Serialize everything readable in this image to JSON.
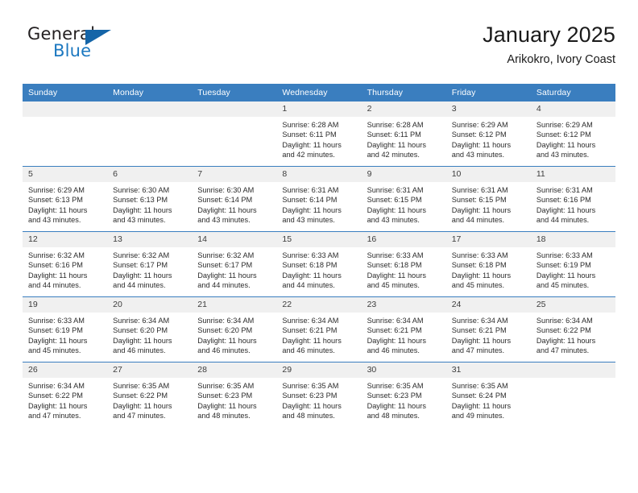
{
  "brand": {
    "name_top": "General",
    "name_bottom": "Blue",
    "flag_icon": "triangle-flag-icon",
    "accent_color": "#1c78c0",
    "flag_color": "#1565a8"
  },
  "header": {
    "title": "January 2025",
    "subtitle": "Arikokro, Ivory Coast"
  },
  "calendar": {
    "header_bg": "#3a7ebf",
    "daynum_bg": "#f0f0f0",
    "weekdays": [
      "Sunday",
      "Monday",
      "Tuesday",
      "Wednesday",
      "Thursday",
      "Friday",
      "Saturday"
    ],
    "weeks": [
      [
        {
          "day": "",
          "empty": true,
          "lines": []
        },
        {
          "day": "",
          "empty": true,
          "lines": []
        },
        {
          "day": "",
          "empty": true,
          "lines": []
        },
        {
          "day": "1",
          "empty": false,
          "lines": [
            "Sunrise: 6:28 AM",
            "Sunset: 6:11 PM",
            "Daylight: 11 hours",
            "and 42 minutes."
          ]
        },
        {
          "day": "2",
          "empty": false,
          "lines": [
            "Sunrise: 6:28 AM",
            "Sunset: 6:11 PM",
            "Daylight: 11 hours",
            "and 42 minutes."
          ]
        },
        {
          "day": "3",
          "empty": false,
          "lines": [
            "Sunrise: 6:29 AM",
            "Sunset: 6:12 PM",
            "Daylight: 11 hours",
            "and 43 minutes."
          ]
        },
        {
          "day": "4",
          "empty": false,
          "lines": [
            "Sunrise: 6:29 AM",
            "Sunset: 6:12 PM",
            "Daylight: 11 hours",
            "and 43 minutes."
          ]
        }
      ],
      [
        {
          "day": "5",
          "empty": false,
          "lines": [
            "Sunrise: 6:29 AM",
            "Sunset: 6:13 PM",
            "Daylight: 11 hours",
            "and 43 minutes."
          ]
        },
        {
          "day": "6",
          "empty": false,
          "lines": [
            "Sunrise: 6:30 AM",
            "Sunset: 6:13 PM",
            "Daylight: 11 hours",
            "and 43 minutes."
          ]
        },
        {
          "day": "7",
          "empty": false,
          "lines": [
            "Sunrise: 6:30 AM",
            "Sunset: 6:14 PM",
            "Daylight: 11 hours",
            "and 43 minutes."
          ]
        },
        {
          "day": "8",
          "empty": false,
          "lines": [
            "Sunrise: 6:31 AM",
            "Sunset: 6:14 PM",
            "Daylight: 11 hours",
            "and 43 minutes."
          ]
        },
        {
          "day": "9",
          "empty": false,
          "lines": [
            "Sunrise: 6:31 AM",
            "Sunset: 6:15 PM",
            "Daylight: 11 hours",
            "and 43 minutes."
          ]
        },
        {
          "day": "10",
          "empty": false,
          "lines": [
            "Sunrise: 6:31 AM",
            "Sunset: 6:15 PM",
            "Daylight: 11 hours",
            "and 44 minutes."
          ]
        },
        {
          "day": "11",
          "empty": false,
          "lines": [
            "Sunrise: 6:31 AM",
            "Sunset: 6:16 PM",
            "Daylight: 11 hours",
            "and 44 minutes."
          ]
        }
      ],
      [
        {
          "day": "12",
          "empty": false,
          "lines": [
            "Sunrise: 6:32 AM",
            "Sunset: 6:16 PM",
            "Daylight: 11 hours",
            "and 44 minutes."
          ]
        },
        {
          "day": "13",
          "empty": false,
          "lines": [
            "Sunrise: 6:32 AM",
            "Sunset: 6:17 PM",
            "Daylight: 11 hours",
            "and 44 minutes."
          ]
        },
        {
          "day": "14",
          "empty": false,
          "lines": [
            "Sunrise: 6:32 AM",
            "Sunset: 6:17 PM",
            "Daylight: 11 hours",
            "and 44 minutes."
          ]
        },
        {
          "day": "15",
          "empty": false,
          "lines": [
            "Sunrise: 6:33 AM",
            "Sunset: 6:18 PM",
            "Daylight: 11 hours",
            "and 44 minutes."
          ]
        },
        {
          "day": "16",
          "empty": false,
          "lines": [
            "Sunrise: 6:33 AM",
            "Sunset: 6:18 PM",
            "Daylight: 11 hours",
            "and 45 minutes."
          ]
        },
        {
          "day": "17",
          "empty": false,
          "lines": [
            "Sunrise: 6:33 AM",
            "Sunset: 6:18 PM",
            "Daylight: 11 hours",
            "and 45 minutes."
          ]
        },
        {
          "day": "18",
          "empty": false,
          "lines": [
            "Sunrise: 6:33 AM",
            "Sunset: 6:19 PM",
            "Daylight: 11 hours",
            "and 45 minutes."
          ]
        }
      ],
      [
        {
          "day": "19",
          "empty": false,
          "lines": [
            "Sunrise: 6:33 AM",
            "Sunset: 6:19 PM",
            "Daylight: 11 hours",
            "and 45 minutes."
          ]
        },
        {
          "day": "20",
          "empty": false,
          "lines": [
            "Sunrise: 6:34 AM",
            "Sunset: 6:20 PM",
            "Daylight: 11 hours",
            "and 46 minutes."
          ]
        },
        {
          "day": "21",
          "empty": false,
          "lines": [
            "Sunrise: 6:34 AM",
            "Sunset: 6:20 PM",
            "Daylight: 11 hours",
            "and 46 minutes."
          ]
        },
        {
          "day": "22",
          "empty": false,
          "lines": [
            "Sunrise: 6:34 AM",
            "Sunset: 6:21 PM",
            "Daylight: 11 hours",
            "and 46 minutes."
          ]
        },
        {
          "day": "23",
          "empty": false,
          "lines": [
            "Sunrise: 6:34 AM",
            "Sunset: 6:21 PM",
            "Daylight: 11 hours",
            "and 46 minutes."
          ]
        },
        {
          "day": "24",
          "empty": false,
          "lines": [
            "Sunrise: 6:34 AM",
            "Sunset: 6:21 PM",
            "Daylight: 11 hours",
            "and 47 minutes."
          ]
        },
        {
          "day": "25",
          "empty": false,
          "lines": [
            "Sunrise: 6:34 AM",
            "Sunset: 6:22 PM",
            "Daylight: 11 hours",
            "and 47 minutes."
          ]
        }
      ],
      [
        {
          "day": "26",
          "empty": false,
          "lines": [
            "Sunrise: 6:34 AM",
            "Sunset: 6:22 PM",
            "Daylight: 11 hours",
            "and 47 minutes."
          ]
        },
        {
          "day": "27",
          "empty": false,
          "lines": [
            "Sunrise: 6:35 AM",
            "Sunset: 6:22 PM",
            "Daylight: 11 hours",
            "and 47 minutes."
          ]
        },
        {
          "day": "28",
          "empty": false,
          "lines": [
            "Sunrise: 6:35 AM",
            "Sunset: 6:23 PM",
            "Daylight: 11 hours",
            "and 48 minutes."
          ]
        },
        {
          "day": "29",
          "empty": false,
          "lines": [
            "Sunrise: 6:35 AM",
            "Sunset: 6:23 PM",
            "Daylight: 11 hours",
            "and 48 minutes."
          ]
        },
        {
          "day": "30",
          "empty": false,
          "lines": [
            "Sunrise: 6:35 AM",
            "Sunset: 6:23 PM",
            "Daylight: 11 hours",
            "and 48 minutes."
          ]
        },
        {
          "day": "31",
          "empty": false,
          "lines": [
            "Sunrise: 6:35 AM",
            "Sunset: 6:24 PM",
            "Daylight: 11 hours",
            "and 49 minutes."
          ]
        },
        {
          "day": "",
          "empty": true,
          "lines": []
        }
      ]
    ]
  }
}
